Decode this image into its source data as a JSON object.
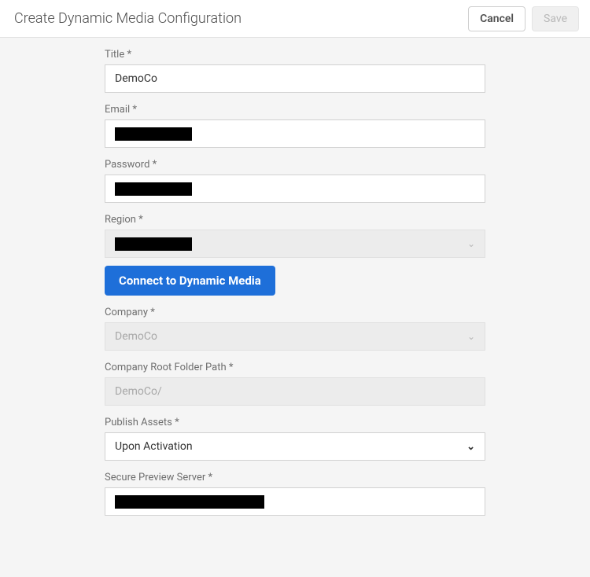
{
  "header": {
    "title": "Create Dynamic Media Configuration",
    "cancel_label": "Cancel",
    "save_label": "Save"
  },
  "form": {
    "title": {
      "label": "Title *",
      "value": "DemoCo"
    },
    "email": {
      "label": "Email *",
      "value": ""
    },
    "password": {
      "label": "Password *",
      "value": ""
    },
    "region": {
      "label": "Region *",
      "value": ""
    },
    "connect_label": "Connect to Dynamic Media",
    "company": {
      "label": "Company *",
      "value": "DemoCo"
    },
    "company_root": {
      "label": "Company Root Folder Path *",
      "value": "DemoCo/"
    },
    "publish_assets": {
      "label": "Publish Assets *",
      "value": "Upon Activation"
    },
    "secure_preview": {
      "label": "Secure Preview Server *",
      "value": ""
    }
  }
}
